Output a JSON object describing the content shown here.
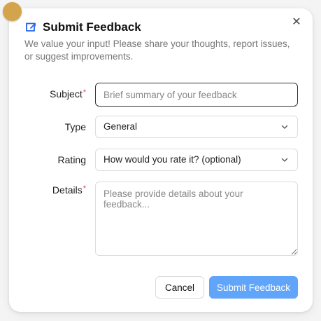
{
  "dialog": {
    "title": "Submit Feedback",
    "subtitle": "We value your input! Please share your thoughts, report issues, or suggest improvements.",
    "close_glyph": "✕",
    "title_icon": "feedback-icon",
    "accent": "#60a5fa"
  },
  "form": {
    "subject": {
      "label": "Subject",
      "required_mark": "*",
      "placeholder": "Brief summary of your feedback",
      "value": ""
    },
    "type": {
      "label": "Type",
      "selected": "General"
    },
    "rating": {
      "label": "Rating",
      "selected": "How would you rate it? (optional)"
    },
    "details": {
      "label": "Details",
      "required_mark": "*",
      "placeholder": "Please provide details about your feedback...",
      "value": ""
    }
  },
  "actions": {
    "cancel_label": "Cancel",
    "submit_label": "Submit Feedback"
  }
}
